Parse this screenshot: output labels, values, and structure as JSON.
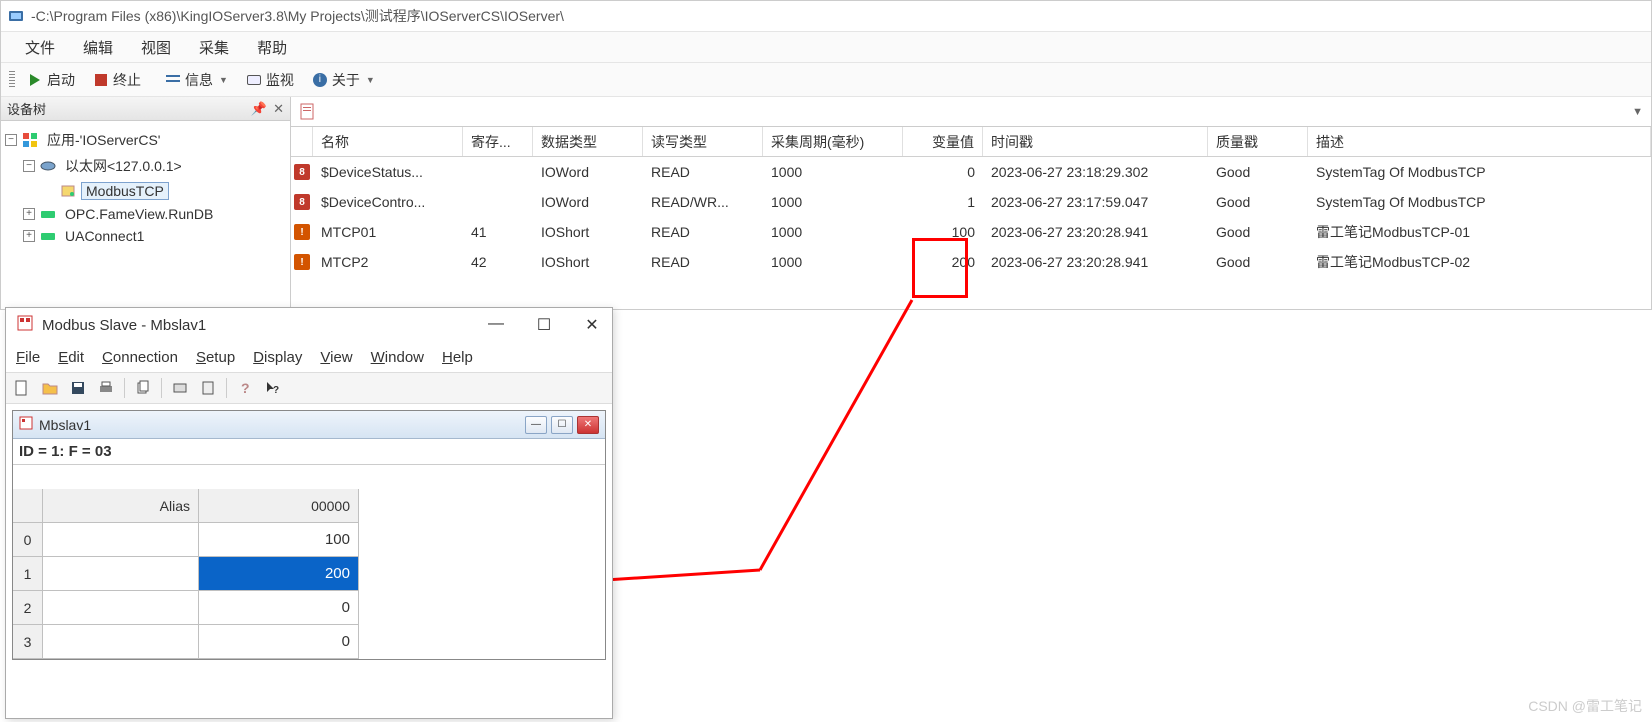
{
  "main": {
    "title": " -C:\\Program Files (x86)\\KingIOServer3.8\\My Projects\\测试程序\\IOServerCS\\IOServer\\",
    "menus": [
      "文件",
      "编辑",
      "视图",
      "采集",
      "帮助"
    ],
    "toolbar": {
      "start": "启动",
      "stop": "终止",
      "info": "信息",
      "monitor": "监视",
      "about": "关于"
    },
    "sidebar": {
      "title": "设备树",
      "root": "应用-'IOServerCS'",
      "ethernet": "以太网<127.0.0.1>",
      "modbus": "ModbusTCP",
      "opc": "OPC.FameView.RunDB",
      "ua": "UAConnect1"
    },
    "grid": {
      "headers": {
        "name": "名称",
        "reg": "寄存...",
        "dtype": "数据类型",
        "rw": "读写类型",
        "cycle": "采集周期(毫秒)",
        "val": "变量值",
        "ts": "时间戳",
        "quality": "质量戳",
        "desc": "描述"
      },
      "rows": [
        {
          "name": "$DeviceStatus...",
          "reg": "",
          "dtype": "IOWord",
          "rw": "READ",
          "cycle": "1000",
          "val": "0",
          "ts": "2023-06-27 23:18:29.302",
          "quality": "Good",
          "desc": "SystemTag Of ModbusTCP",
          "icon": "err"
        },
        {
          "name": "$DeviceContro...",
          "reg": "",
          "dtype": "IOWord",
          "rw": "READ/WR...",
          "cycle": "1000",
          "val": "1",
          "ts": "2023-06-27 23:17:59.047",
          "quality": "Good",
          "desc": "SystemTag Of ModbusTCP",
          "icon": "err"
        },
        {
          "name": "MTCP01",
          "reg": "41",
          "dtype": "IOShort",
          "rw": "READ",
          "cycle": "1000",
          "val": "100",
          "ts": "2023-06-27 23:20:28.941",
          "quality": "Good",
          "desc": "雷工笔记ModbusTCP-01",
          "icon": "warn"
        },
        {
          "name": "MTCP2",
          "reg": "42",
          "dtype": "IOShort",
          "rw": "READ",
          "cycle": "1000",
          "val": "200",
          "ts": "2023-06-27 23:20:28.941",
          "quality": "Good",
          "desc": "雷工笔记ModbusTCP-02",
          "icon": "warn"
        }
      ]
    }
  },
  "modbus": {
    "title": "Modbus Slave - Mbslav1",
    "menus": {
      "file": "File",
      "edit": "Edit",
      "connection": "Connection",
      "setup": "Setup",
      "display": "Display",
      "view": "View",
      "window": "Window",
      "help": "Help"
    },
    "inner_title": "Mbslav1",
    "status": "ID = 1: F = 03",
    "grid": {
      "alias_header": "Alias",
      "col_header": "00000",
      "rows": [
        {
          "idx": "0",
          "alias": "",
          "val": "100"
        },
        {
          "idx": "1",
          "alias": "",
          "val": "200"
        },
        {
          "idx": "2",
          "alias": "",
          "val": "0"
        },
        {
          "idx": "3",
          "alias": "",
          "val": "0"
        }
      ]
    }
  },
  "watermark": "CSDN @雷工笔记"
}
